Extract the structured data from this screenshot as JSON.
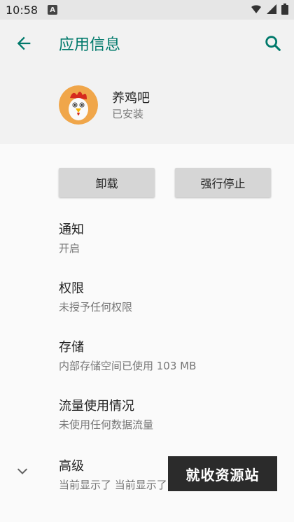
{
  "status_bar": {
    "time": "10:58",
    "notif_glyph": "A"
  },
  "header": {
    "title": "应用信息"
  },
  "app": {
    "name": "养鸡吧",
    "status": "已安装"
  },
  "buttons": {
    "uninstall": "卸载",
    "force_stop": "强行停止"
  },
  "items": [
    {
      "title": "通知",
      "subtitle": "开启"
    },
    {
      "title": "权限",
      "subtitle": "未授予任何权限"
    },
    {
      "title": "存储",
      "subtitle": "内部存储空间已使用 103 MB"
    },
    {
      "title": "流量使用情况",
      "subtitle": "未使用任何数据流量"
    },
    {
      "title": "高级",
      "subtitle": "当前显示了 当前显示了"
    }
  ],
  "watermark": "就收资源站",
  "icons": [
    "back-arrow-icon",
    "search-icon",
    "wifi-icon",
    "signal-icon",
    "battery-icon",
    "chevron-down-icon",
    "app-icon-rooster"
  ],
  "colors": {
    "accent": "#00796b",
    "header_bg": "#f2f2f2",
    "button_bg": "#d6d6d6"
  }
}
